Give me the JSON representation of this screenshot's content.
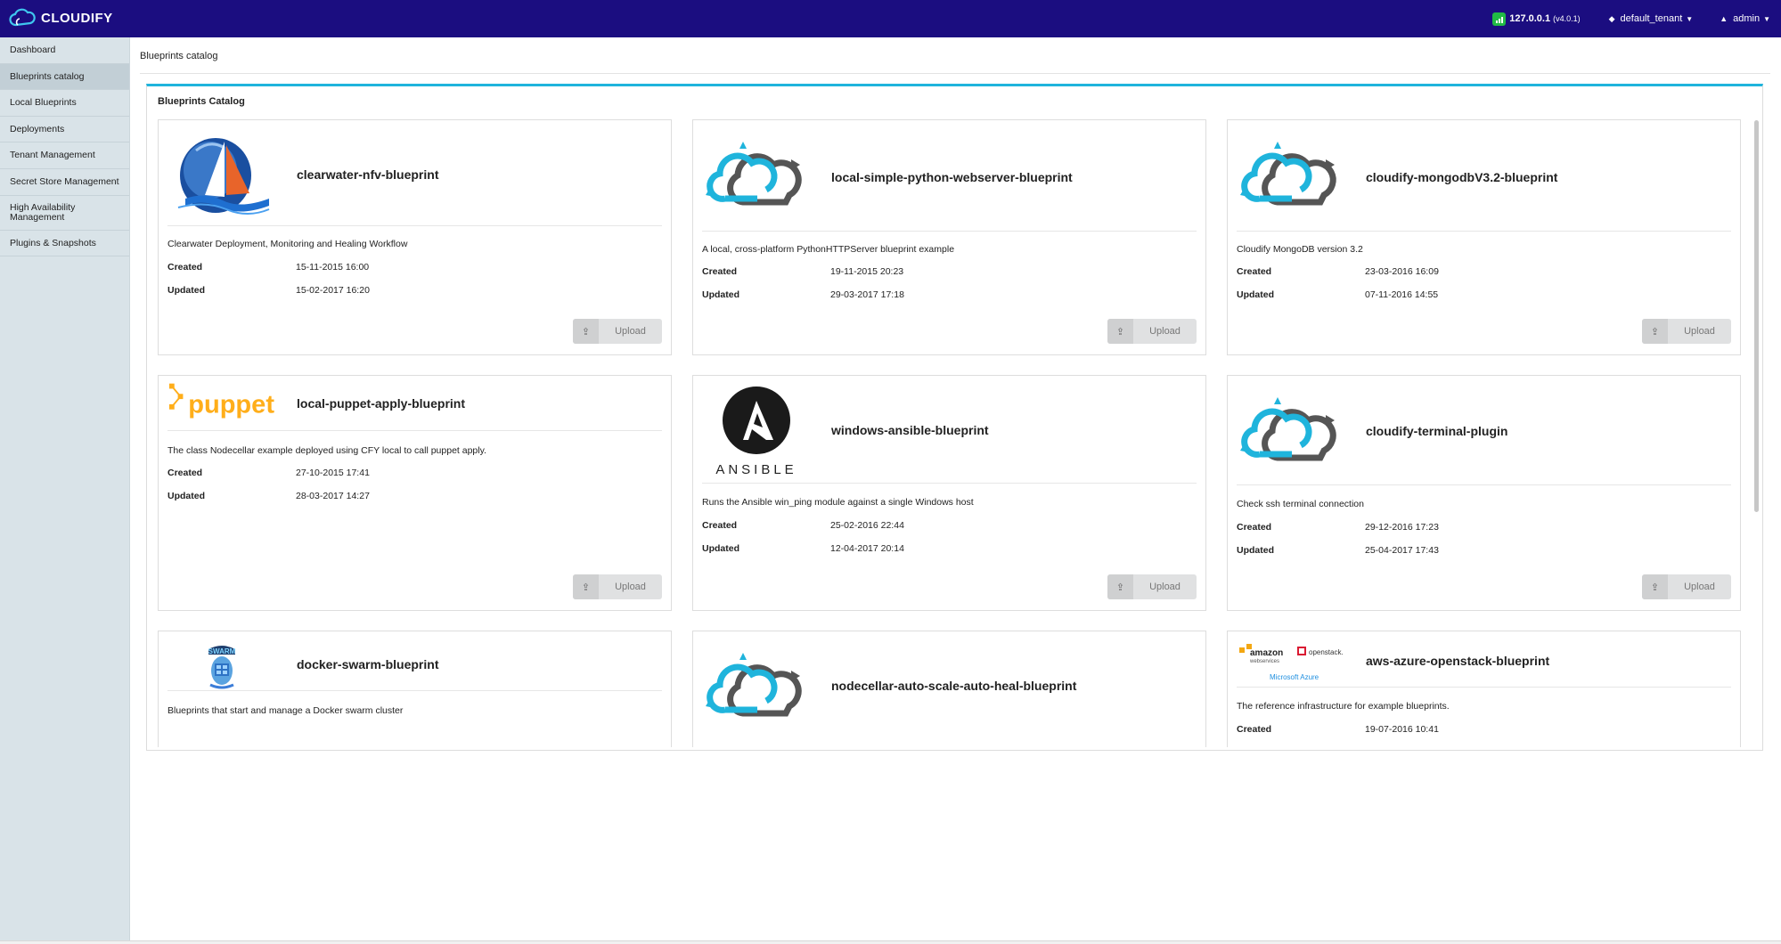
{
  "header": {
    "brand": "CLOUDIFY",
    "server_ip": "127.0.0.1",
    "server_version": "(v4.0.1)",
    "tenant": "default_tenant",
    "user": "admin"
  },
  "sidebar": {
    "items": [
      {
        "label": "Dashboard"
      },
      {
        "label": "Blueprints catalog",
        "active": true
      },
      {
        "label": "Local Blueprints"
      },
      {
        "label": "Deployments"
      },
      {
        "label": "Tenant Management"
      },
      {
        "label": "Secret Store Management"
      },
      {
        "label": "High Availability Management"
      },
      {
        "label": "Plugins & Snapshots"
      }
    ]
  },
  "page": {
    "title": "Blueprints catalog"
  },
  "widget": {
    "title": "Blueprints Catalog"
  },
  "labels": {
    "created": "Created",
    "updated": "Updated",
    "upload": "Upload"
  },
  "cards": [
    {
      "name": "clearwater-nfv-blueprint",
      "description": "Clearwater Deployment, Monitoring and Healing Workflow",
      "created": "15-11-2015 16:00",
      "updated": "15-02-2017 16:20",
      "logo": "clearwater-logo"
    },
    {
      "name": "local-simple-python-webserver-blueprint",
      "description": "A local, cross-platform PythonHTTPServer blueprint example",
      "created": "19-11-2015 20:23",
      "updated": "29-03-2017 17:18",
      "logo": "cloudify-cloud-logo"
    },
    {
      "name": "cloudify-mongodbV3.2-blueprint",
      "description": "Cloudify MongoDB version 3.2",
      "created": "23-03-2016 16:09",
      "updated": "07-11-2016 14:55",
      "logo": "cloudify-cloud-logo"
    },
    {
      "name": "local-puppet-apply-blueprint",
      "description": "The class Nodecellar example deployed using CFY local to call puppet apply.",
      "created": "27-10-2015 17:41",
      "updated": "28-03-2017 14:27",
      "logo": "puppet-logo",
      "logo_text": "puppet"
    },
    {
      "name": "windows-ansible-blueprint",
      "description": "Runs the Ansible win_ping module against a single Windows host",
      "created": "25-02-2016 22:44",
      "updated": "12-04-2017 20:14",
      "logo": "ansible-logo",
      "logo_text": "ANSIBLE"
    },
    {
      "name": "cloudify-terminal-plugin",
      "description": "Check ssh terminal connection",
      "created": "29-12-2016 17:23",
      "updated": "25-04-2017 17:43",
      "logo": "cloudify-cloud-logo"
    },
    {
      "name": "docker-swarm-blueprint",
      "description": "Blueprints that start and manage a Docker swarm cluster",
      "logo": "docker-swarm-logo",
      "logo_text": "SWARM"
    },
    {
      "name": "nodecellar-auto-scale-auto-heal-blueprint",
      "logo": "cloudify-cloud-logo"
    },
    {
      "name": "aws-azure-openstack-blueprint",
      "description": "The reference infrastructure for example blueprints.",
      "created": "19-07-2016 10:41",
      "logo": "aws-azure-openstack-logo",
      "logo_text_amazon": "amazon",
      "logo_text_aws": "webservices",
      "logo_text_openstack": "openstack.",
      "logo_text_azure": "Microsoft Azure"
    }
  ],
  "colors": {
    "topbar": "#1b0d80",
    "sidebar": "#d9e3e8",
    "accent": "#1fb4dc",
    "status_green": "#21ba45",
    "cloud_cyan": "#1fb4dc",
    "cloud_gray": "#555555",
    "puppet_orange": "#ffae1a"
  }
}
